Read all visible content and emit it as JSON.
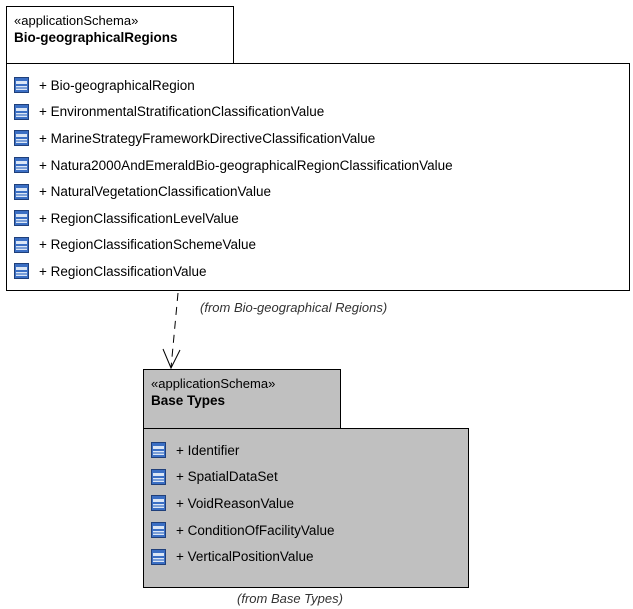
{
  "packages": {
    "bio": {
      "stereotype": "«applicationSchema»",
      "name": "Bio-geographicalRegions",
      "from": "(from Bio-geographical Regions)",
      "items": [
        "+ Bio-geographicalRegion",
        "+ EnvironmentalStratificationClassificationValue",
        "+ MarineStrategyFrameworkDirectiveClassificationValue",
        "+ Natura2000AndEmeraldBio-geographicalRegionClassificationValue",
        "+ NaturalVegetationClassificationValue",
        "+ RegionClassificationLevelValue",
        "+ RegionClassificationSchemeValue",
        "+ RegionClassificationValue"
      ]
    },
    "base": {
      "stereotype": "«applicationSchema»",
      "name": "Base Types",
      "from": "(from Base Types)",
      "items": [
        "+ Identifier",
        "+ SpatialDataSet",
        "+ VoidReasonValue",
        "+ ConditionOfFacilityValue",
        "+ VerticalPositionValue"
      ]
    }
  },
  "colors": {
    "base_fill": "#c0c0c0",
    "icon_blue": "#3b6fc4",
    "icon_light": "#dbe6f5"
  },
  "icon": "class-element-icon",
  "connector": "dependency-dashed-arrow"
}
